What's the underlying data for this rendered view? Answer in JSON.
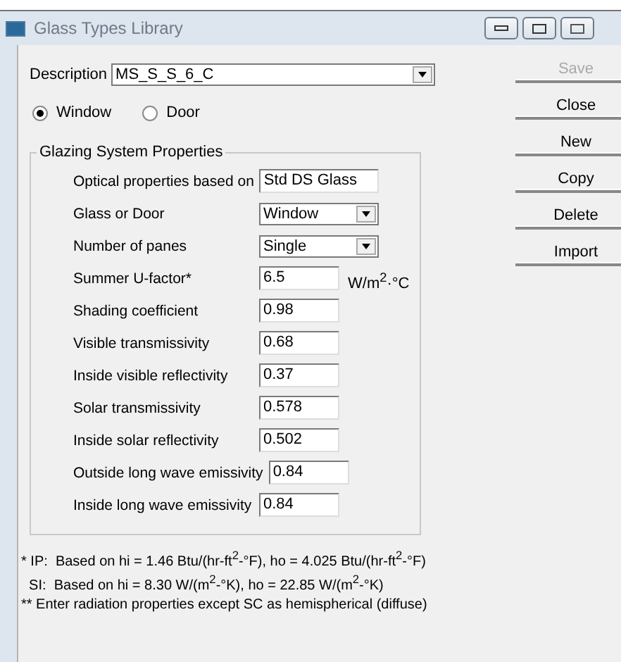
{
  "window": {
    "title": "Glass Types Library"
  },
  "description": {
    "label": "Description",
    "value": "MS_S_S_6_C"
  },
  "type_options": [
    {
      "label": "Window",
      "selected": true
    },
    {
      "label": "Door",
      "selected": false
    }
  ],
  "group": {
    "title": "Glazing System Properties",
    "rows": [
      {
        "kind": "text",
        "label": "Optical properties based on",
        "value": "Std DS Glass"
      },
      {
        "kind": "combo",
        "label": "Glass or Door",
        "value": "Window"
      },
      {
        "kind": "combo",
        "label": "Number of panes",
        "value": "Single"
      },
      {
        "kind": "number",
        "label": "Summer U-factor*",
        "value": "6.5",
        "unit": "W/m$^{2}$·°C"
      },
      {
        "kind": "number",
        "label": "Shading coefficient",
        "value": "0.98"
      },
      {
        "kind": "number",
        "label": "Visible transmissivity",
        "value": "0.68"
      },
      {
        "kind": "number",
        "label": "Inside visible reflectivity",
        "value": "0.37"
      },
      {
        "kind": "number",
        "label": "Solar transmissivity",
        "value": "0.578"
      },
      {
        "kind": "number",
        "label": "Inside solar reflectivity",
        "value": "0.502"
      },
      {
        "kind": "number",
        "label": "Outside long wave emissivity",
        "value": "0.84"
      },
      {
        "kind": "number",
        "label": "Inside long wave emissivity",
        "value": "0.84"
      }
    ]
  },
  "footnotes": [
    "* IP:  Based on hi = 1.46 Btu/(hr-ft$^{2}$-°F), ho = 4.025 Btu/(hr-ft$^{2}$-°F)",
    "  SI:  Based on hi = 8.30 W/(m$^{2}$-°K), ho = 22.85 W/(m$^{2}$-°K)",
    "** Enter radiation properties except SC as hemispherical (diffuse)"
  ],
  "buttons": [
    {
      "label": "Save",
      "disabled": true
    },
    {
      "label": "Close",
      "disabled": false
    },
    {
      "label": "New",
      "disabled": false
    },
    {
      "label": "Copy",
      "disabled": false
    },
    {
      "label": "Delete",
      "disabled": false
    },
    {
      "label": "Import",
      "disabled": false
    }
  ]
}
